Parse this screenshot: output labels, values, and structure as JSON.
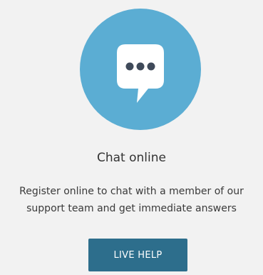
{
  "card": {
    "icon": "chat-bubble-icon",
    "title": "Chat online",
    "description": "Register online to chat with a member of our support team and get immediate answers",
    "button_label": "LIVE HELP"
  },
  "colors": {
    "background": "#f2f2f2",
    "circle": "#5badd3",
    "circle_edge": "#4f9fc6",
    "bubble": "#ffffff",
    "dots": "#3f4a5a",
    "button": "#2d6e8c",
    "title_text": "#333333",
    "body_text": "#3a3a3a"
  }
}
